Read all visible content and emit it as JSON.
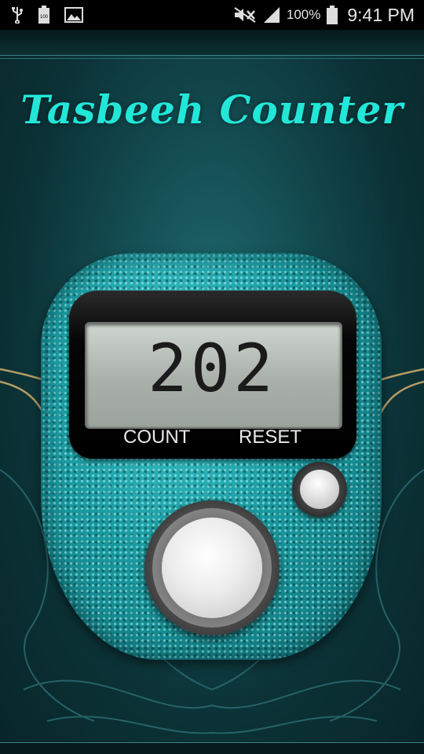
{
  "status_bar": {
    "battery_percent": "100%",
    "time": "9:41 PM",
    "left_icons": [
      "usb-icon",
      "battery-full-icon",
      "image-icon"
    ],
    "right_icons": [
      "mute-icon",
      "signal-icon",
      "battery-icon"
    ]
  },
  "app": {
    "title": "Tasbeeh Counter",
    "counter_value": "202",
    "count_label": "COUNT",
    "reset_label": "RESET"
  },
  "colors": {
    "title": "#22e6d8",
    "device": "#1b9aa1",
    "background": "#134b50"
  }
}
